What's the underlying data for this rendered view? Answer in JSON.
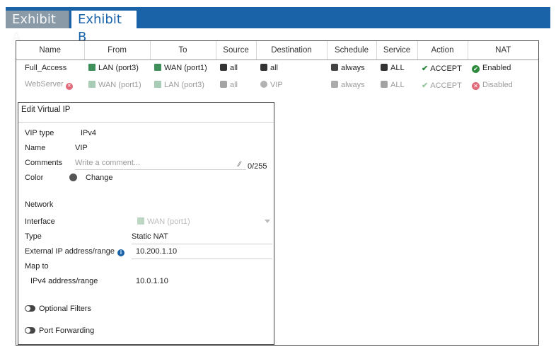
{
  "tabs": [
    {
      "label": "Exhibit A",
      "active": false
    },
    {
      "label": "Exhibit B",
      "active": true
    }
  ],
  "policy": {
    "headers": [
      "Name",
      "From",
      "To",
      "Source",
      "Destination",
      "Schedule",
      "Service",
      "Action",
      "NAT"
    ],
    "rows": [
      {
        "name": "Full_Access",
        "from": "LAN (port3)",
        "to": "WAN (port1)",
        "source": "all",
        "destination": "all",
        "schedule": "always",
        "service": "ALL",
        "action": "ACCEPT",
        "nat": "Enabled"
      },
      {
        "name": "WebServer",
        "from": "WAN (port1)",
        "to": "LAN (port3)",
        "source": "all",
        "destination": "VIP",
        "schedule": "always",
        "service": "ALL",
        "action": "ACCEPT",
        "nat": "Disabled"
      }
    ]
  },
  "vip": {
    "title": "Edit Virtual IP",
    "vip_type_label": "VIP type",
    "vip_type_value": "IPv4",
    "name_label": "Name",
    "name_value": "VIP",
    "comments_label": "Comments",
    "comments_placeholder": "Write a comment...",
    "comments_count": "0/255",
    "color_label": "Color",
    "color_action": "Change",
    "network_heading": "Network",
    "interface_label": "Interface",
    "interface_value": "WAN (port1)",
    "type_label": "Type",
    "type_value": "Static NAT",
    "external_label": "External IP address/range",
    "external_value": "10.200.1.10",
    "map_to_label": "Map to",
    "ipv4_label": "IPv4 address/range",
    "ipv4_value": "10.0.1.10",
    "optional_filters": "Optional Filters",
    "port_forwarding": "Port Forwarding"
  },
  "colors": {
    "tabbar": "#1a63a8",
    "accept": "#2e8b3e",
    "disabled": "#e06a7a"
  }
}
